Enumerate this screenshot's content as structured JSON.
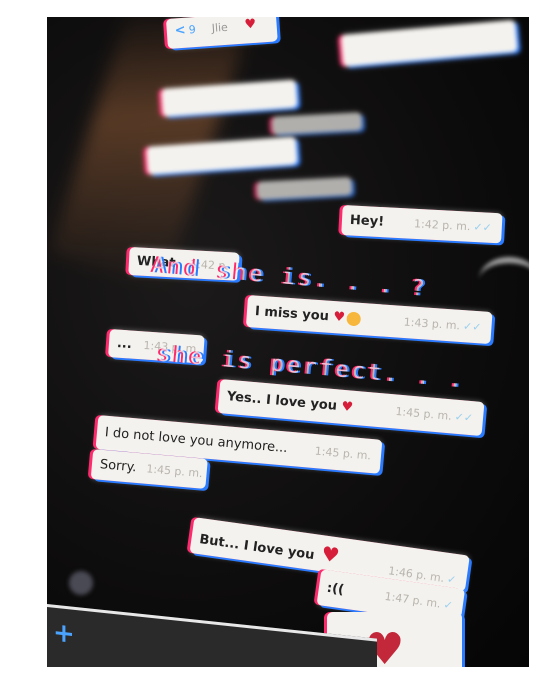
{
  "header": {
    "contact": "Jlie",
    "back_count": "9"
  },
  "messages": [
    {
      "id": "m1",
      "text": "Hey!",
      "time": "1:42 p. m.",
      "ticks": "✓✓"
    },
    {
      "id": "m2",
      "text": "What",
      "time": "1:42 p."
    },
    {
      "id": "m3",
      "text": "I miss you",
      "time": "1:43 p. m.",
      "ticks": "✓✓"
    },
    {
      "id": "m4",
      "text": "...",
      "time": "1:43 p. m."
    },
    {
      "id": "m5",
      "text": "Yes.. I love you",
      "time": "1:45 p. m.",
      "ticks": "✓✓"
    },
    {
      "id": "m6",
      "text": "I do not love you anymore...",
      "time": "1:45 p. m."
    },
    {
      "id": "m7",
      "text": "Sorry.",
      "time": "1:45 p. m."
    },
    {
      "id": "m8",
      "text": "But... I love you",
      "time": "1:46 p. m.",
      "ticks": "✓"
    },
    {
      "id": "m9",
      "text": ":((",
      "time": "1:47 p. m.",
      "ticks": "✓"
    }
  ],
  "overlay_text": {
    "line1": "And she is. . . ?",
    "line2": "she is perfect. . ."
  },
  "icons": {
    "heart": "red-heart",
    "broken_heart": "broken-heart",
    "plus": "plus-icon"
  },
  "colors": {
    "bubble": "#f4f2ee",
    "background": "#0d0c0c",
    "heart": "#d61e3a",
    "tick": "#9ad0ef"
  }
}
